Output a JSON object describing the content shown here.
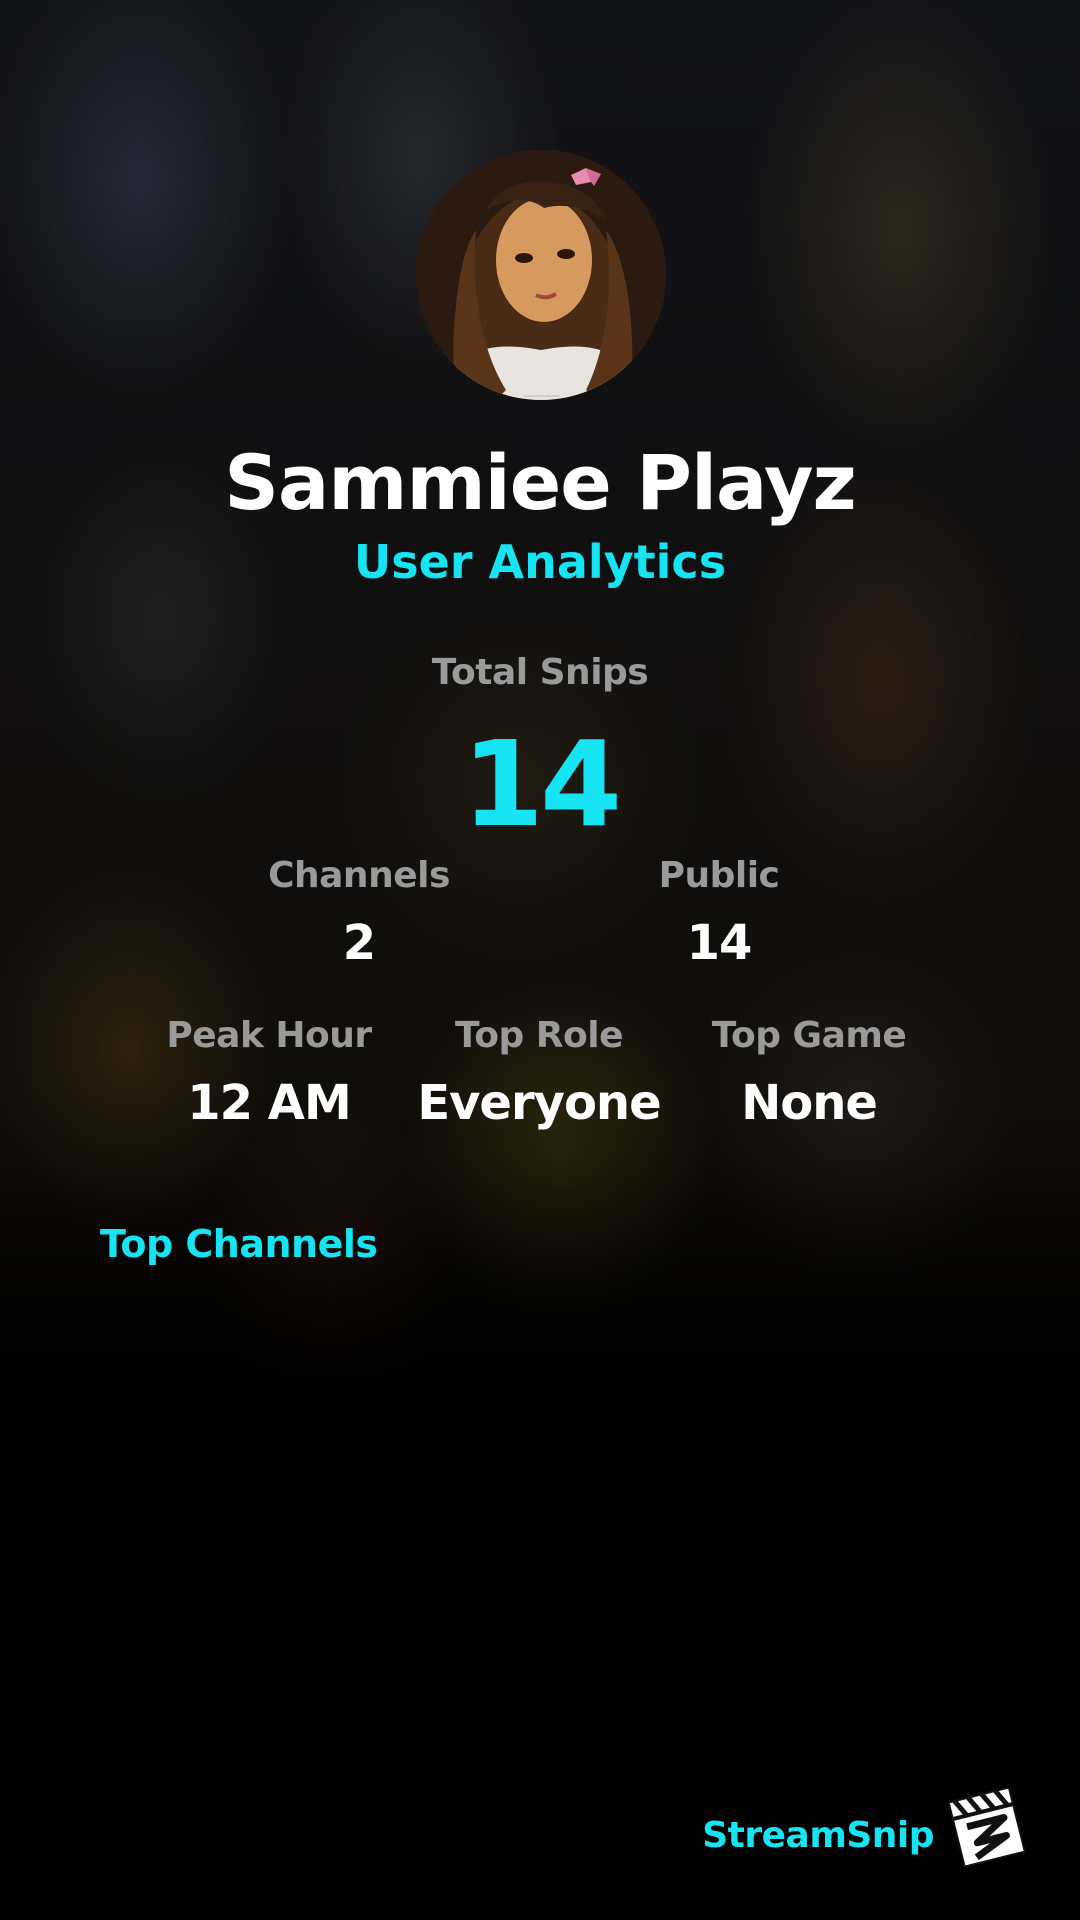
{
  "profile": {
    "name": "Sammiee Playz",
    "subtitle": "User Analytics"
  },
  "stats": {
    "total_snips_label": "Total Snips",
    "total_snips_value": "14",
    "channels_label": "Channels",
    "channels_value": "2",
    "public_label": "Public",
    "public_value": "14",
    "peak_hour_label": "Peak Hour",
    "peak_hour_value": "12 AM",
    "top_role_label": "Top Role",
    "top_role_value": "Everyone",
    "top_game_label": "Top Game",
    "top_game_value": "None"
  },
  "sections": {
    "top_channels_title": "Top Channels"
  },
  "branding": {
    "name": "StreamSnip",
    "logo_icon": "clapperboard-icon"
  },
  "colors": {
    "accent": "#17e4f2",
    "label_gray": "#9a9a9a",
    "background": "#000000"
  }
}
